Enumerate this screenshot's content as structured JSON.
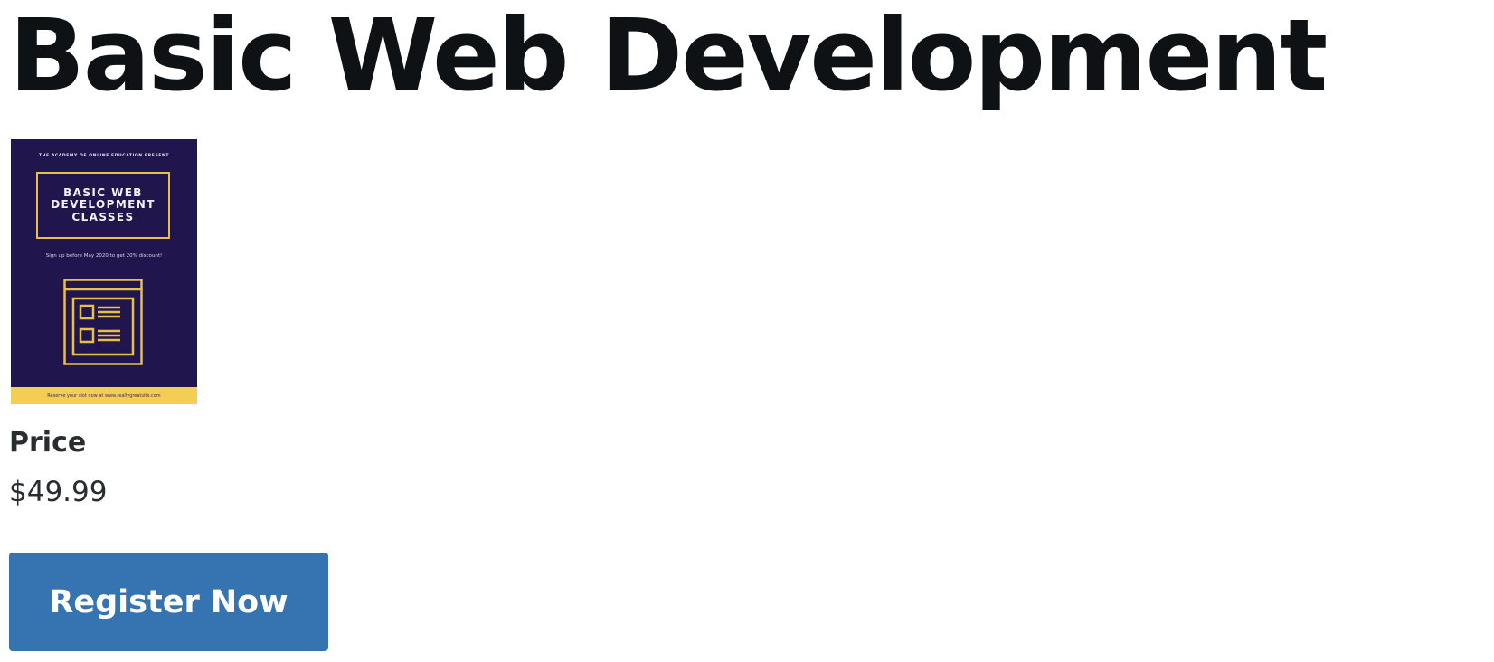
{
  "course": {
    "title": "Basic Web Development"
  },
  "poster": {
    "presenter": "THE ACADEMY OF ONLINE EDUCATION PRESENT",
    "heading": "BASIC WEB\nDEVELOPMENT\nCLASSES",
    "discount": "Sign up before May 2020 to get 20% discount!",
    "footer": "Reserve your slot now at www.reallygreatsite.com",
    "icon": "webpage-layout-icon",
    "colors": {
      "background": "#21154d",
      "accent": "#e7bf4c",
      "footer": "#f4cd55"
    }
  },
  "pricing": {
    "label": "Price",
    "value": "$49.99"
  },
  "actions": {
    "register_label": "Register Now",
    "register_color": "#3574b0"
  }
}
